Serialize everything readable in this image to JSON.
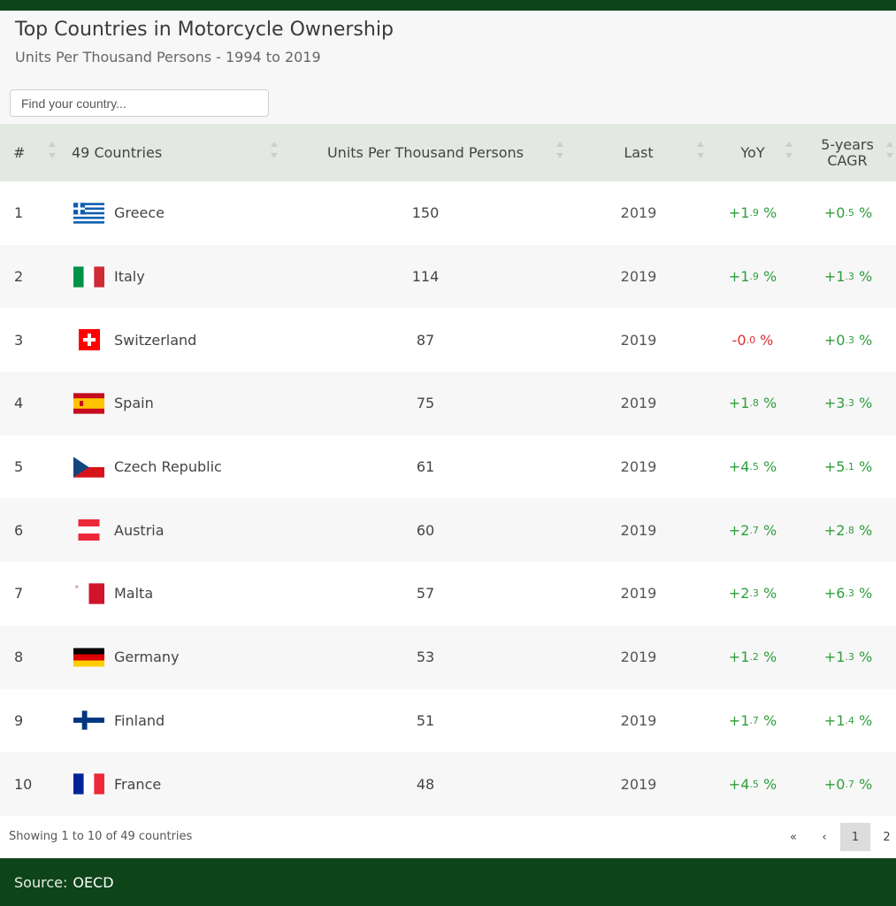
{
  "header": {
    "title": "Top Countries in Motorcycle Ownership",
    "subtitle": "Units Per Thousand Persons - 1994 to 2019",
    "search_placeholder": "Find your country..."
  },
  "columns": {
    "rank": "#",
    "country": "49 Countries",
    "value": "Units Per Thousand Persons",
    "last": "Last",
    "yoy": "YoY",
    "cagr": "5-years CAGR"
  },
  "rows": [
    {
      "rank": "1",
      "country": "Greece",
      "flag": "greece-flag-icon",
      "value": "150",
      "last": "2019",
      "yoy_int": "+1",
      "yoy_dec": ".9",
      "yoy_sign": "pos",
      "cagr_int": "+0",
      "cagr_dec": ".5",
      "cagr_sign": "pos"
    },
    {
      "rank": "2",
      "country": "Italy",
      "flag": "italy-flag-icon",
      "value": "114",
      "last": "2019",
      "yoy_int": "+1",
      "yoy_dec": ".9",
      "yoy_sign": "pos",
      "cagr_int": "+1",
      "cagr_dec": ".3",
      "cagr_sign": "pos"
    },
    {
      "rank": "3",
      "country": "Switzerland",
      "flag": "switzerland-flag-icon",
      "value": "87",
      "last": "2019",
      "yoy_int": "-0",
      "yoy_dec": ".0",
      "yoy_sign": "neg",
      "cagr_int": "+0",
      "cagr_dec": ".3",
      "cagr_sign": "pos"
    },
    {
      "rank": "4",
      "country": "Spain",
      "flag": "spain-flag-icon",
      "value": "75",
      "last": "2019",
      "yoy_int": "+1",
      "yoy_dec": ".8",
      "yoy_sign": "pos",
      "cagr_int": "+3",
      "cagr_dec": ".3",
      "cagr_sign": "pos"
    },
    {
      "rank": "5",
      "country": "Czech Republic",
      "flag": "czech-flag-icon",
      "value": "61",
      "last": "2019",
      "yoy_int": "+4",
      "yoy_dec": ".5",
      "yoy_sign": "pos",
      "cagr_int": "+5",
      "cagr_dec": ".1",
      "cagr_sign": "pos"
    },
    {
      "rank": "6",
      "country": "Austria",
      "flag": "austria-flag-icon",
      "value": "60",
      "last": "2019",
      "yoy_int": "+2",
      "yoy_dec": ".7",
      "yoy_sign": "pos",
      "cagr_int": "+2",
      "cagr_dec": ".8",
      "cagr_sign": "pos"
    },
    {
      "rank": "7",
      "country": "Malta",
      "flag": "malta-flag-icon",
      "value": "57",
      "last": "2019",
      "yoy_int": "+2",
      "yoy_dec": ".3",
      "yoy_sign": "pos",
      "cagr_int": "+6",
      "cagr_dec": ".3",
      "cagr_sign": "pos"
    },
    {
      "rank": "8",
      "country": "Germany",
      "flag": "germany-flag-icon",
      "value": "53",
      "last": "2019",
      "yoy_int": "+1",
      "yoy_dec": ".2",
      "yoy_sign": "pos",
      "cagr_int": "+1",
      "cagr_dec": ".3",
      "cagr_sign": "pos"
    },
    {
      "rank": "9",
      "country": "Finland",
      "flag": "finland-flag-icon",
      "value": "51",
      "last": "2019",
      "yoy_int": "+1",
      "yoy_dec": ".7",
      "yoy_sign": "pos",
      "cagr_int": "+1",
      "cagr_dec": ".4",
      "cagr_sign": "pos"
    },
    {
      "rank": "10",
      "country": "France",
      "flag": "france-flag-icon",
      "value": "48",
      "last": "2019",
      "yoy_int": "+4",
      "yoy_dec": ".5",
      "yoy_sign": "pos",
      "cagr_int": "+0",
      "cagr_dec": ".7",
      "cagr_sign": "pos"
    }
  ],
  "pagination": {
    "info": "Showing 1 to 10 of 49 countries",
    "first": "«",
    "prev": "‹",
    "page1": "1",
    "page2": "2"
  },
  "source": {
    "label": "Source:",
    "name": "OECD"
  },
  "colors": {
    "brand_green": "#0e4419",
    "positive": "#2f9e3c",
    "negative": "#e02f2f",
    "header_bg": "#e3e8e3"
  }
}
